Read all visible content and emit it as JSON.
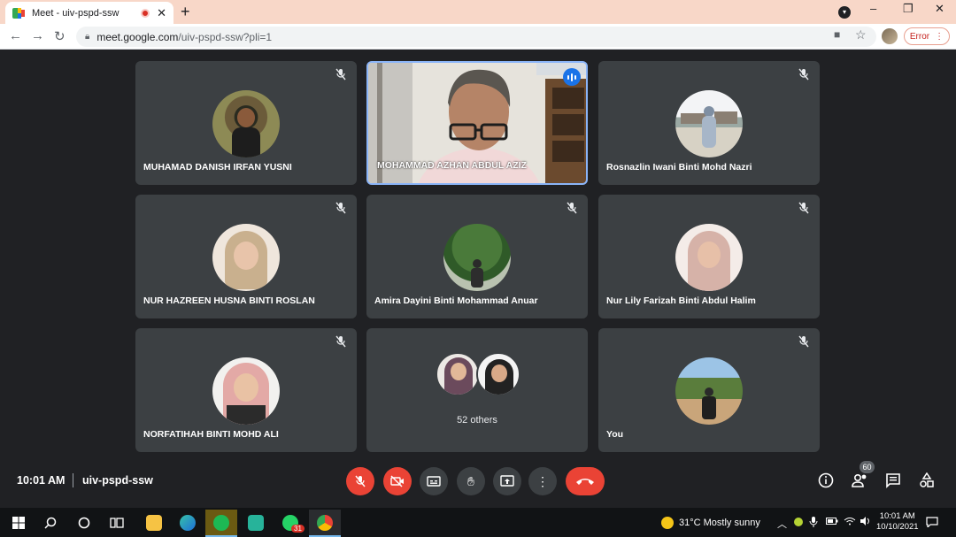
{
  "browser": {
    "tab_title": "Meet - uiv-pspd-ssw",
    "new_tab_label": "+",
    "url_host": "meet.google.com",
    "url_path": "/uiv-pspd-ssw?pli=1",
    "error_label": "Error"
  },
  "tiles": [
    {
      "name": "MUHAMAD DANISH IRFAN YUSNI",
      "muted": true
    },
    {
      "name": "MOHAMMAD AZHAN ABDUL AZIZ",
      "muted": false,
      "speaking": true
    },
    {
      "name": "Rosnazlin Iwani Binti Mohd Nazri",
      "muted": true
    },
    {
      "name": "NUR HAZREEN HUSNA BINTI ROSLAN",
      "muted": true
    },
    {
      "name": "Amira Dayini Binti Mohammad Anuar",
      "muted": true
    },
    {
      "name": "Nur Lily Farizah Binti Abdul Halim",
      "muted": true
    },
    {
      "name": "NORFATIHAH BINTI MOHD ALI",
      "muted": true
    },
    {
      "name": "52 others",
      "muted": false
    },
    {
      "name": "You",
      "muted": true
    }
  ],
  "meeting": {
    "time": "10:01 AM",
    "code": "uiv-pspd-ssw",
    "participant_count": "60"
  },
  "taskbar": {
    "weather": "31°C  Mostly sunny",
    "time": "10:01 AM",
    "date": "10/10/2021",
    "whatsapp_badge": "31"
  },
  "colors": {
    "background": "#202124",
    "tile": "#3c4043",
    "danger": "#ea4335",
    "accent": "#1a73e8",
    "active_border": "#8ab4f8"
  }
}
